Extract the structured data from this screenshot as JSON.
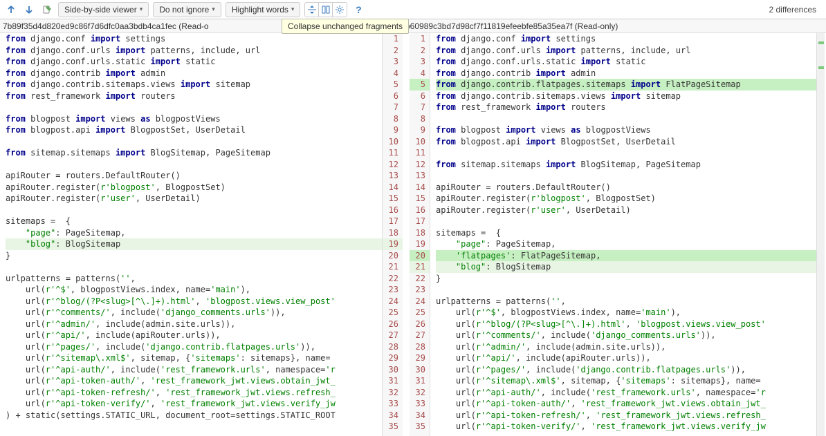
{
  "toolbar": {
    "viewer_mode": "Side-by-side viewer",
    "ignore_mode": "Do not ignore",
    "highlight_mode": "Highlight words",
    "diff_count": "2 differences"
  },
  "tooltip": "Collapse unchanged fragments",
  "headers": {
    "left": "7b89f35d4d820ed9c86f7d6dfc0aa3bdb4ca1fec (Read-o",
    "right": "b60989c3bd7d98cf7f11819efeebfe85a35ea7f (Read-only)"
  },
  "left": {
    "start": 1,
    "lines": [
      {
        "t": [
          [
            "kw",
            "from"
          ],
          [
            "",
            " django.conf "
          ],
          [
            "kw",
            "import"
          ],
          [
            "",
            " settings"
          ]
        ]
      },
      {
        "t": [
          [
            "kw",
            "from"
          ],
          [
            "",
            " django.conf.urls "
          ],
          [
            "kw",
            "import"
          ],
          [
            "",
            " patterns, include, url"
          ]
        ]
      },
      {
        "t": [
          [
            "kw",
            "from"
          ],
          [
            "",
            " django.conf.urls.static "
          ],
          [
            "kw",
            "import"
          ],
          [
            "",
            " static"
          ]
        ]
      },
      {
        "t": [
          [
            "kw",
            "from"
          ],
          [
            "",
            " django.contrib "
          ],
          [
            "kw",
            "import"
          ],
          [
            "",
            " admin"
          ]
        ]
      },
      {
        "t": [
          [
            "kw",
            "from"
          ],
          [
            "",
            " django.contrib.sitemaps.views "
          ],
          [
            "kw",
            "import"
          ],
          [
            "",
            " sitemap"
          ]
        ]
      },
      {
        "t": [
          [
            "kw",
            "from"
          ],
          [
            "",
            " rest_framework "
          ],
          [
            "kw",
            "import"
          ],
          [
            "",
            " routers"
          ]
        ]
      },
      {
        "t": []
      },
      {
        "t": [
          [
            "kw",
            "from"
          ],
          [
            "",
            " blogpost "
          ],
          [
            "kw",
            "import"
          ],
          [
            "",
            " views "
          ],
          [
            "kw",
            "as"
          ],
          [
            "",
            " blogpostViews"
          ]
        ]
      },
      {
        "t": [
          [
            "kw",
            "from"
          ],
          [
            "",
            " blogpost.api "
          ],
          [
            "kw",
            "import"
          ],
          [
            "",
            " BlogpostSet, UserDetail"
          ]
        ]
      },
      {
        "t": []
      },
      {
        "t": [
          [
            "kw",
            "from"
          ],
          [
            "",
            " sitemap.sitemaps "
          ],
          [
            "kw",
            "import"
          ],
          [
            "",
            " BlogSitemap, PageSitemap"
          ]
        ]
      },
      {
        "t": []
      },
      {
        "t": [
          [
            "",
            "apiRouter = routers.DefaultRouter()"
          ]
        ]
      },
      {
        "t": [
          [
            "",
            "apiRouter.register("
          ],
          [
            "str",
            "r'blogpost'"
          ],
          [
            "",
            ", BlogpostSet)"
          ]
        ]
      },
      {
        "t": [
          [
            "",
            "apiRouter.register("
          ],
          [
            "str",
            "r'user'"
          ],
          [
            "",
            ", UserDetail)"
          ]
        ]
      },
      {
        "t": []
      },
      {
        "t": [
          [
            "",
            "sitemaps =  {"
          ]
        ]
      },
      {
        "t": [
          [
            "",
            "    "
          ],
          [
            "str",
            "\"page\""
          ],
          [
            "",
            ": PageSitemap,"
          ]
        ]
      },
      {
        "cls": "mod",
        "t": [
          [
            "",
            "    "
          ],
          [
            "str",
            "\"blog\""
          ],
          [
            "",
            ": BlogSitemap"
          ]
        ]
      },
      {
        "t": [
          [
            "",
            "}"
          ]
        ]
      },
      {
        "t": []
      },
      {
        "t": [
          [
            "",
            "urlpatterns = patterns("
          ],
          [
            "str",
            "''"
          ],
          [
            "",
            ","
          ]
        ]
      },
      {
        "t": [
          [
            "",
            "    url("
          ],
          [
            "str",
            "r'^$'"
          ],
          [
            "",
            ", blogpostViews.index, name="
          ],
          [
            "str",
            "'main'"
          ],
          [
            "",
            "),"
          ]
        ]
      },
      {
        "t": [
          [
            "",
            "    url("
          ],
          [
            "str",
            "r'^blog/(?P<slug>[^\\.]+).html'"
          ],
          [
            "",
            ", "
          ],
          [
            "str",
            "'blogpost.views.view_post'"
          ]
        ]
      },
      {
        "t": [
          [
            "",
            "    url("
          ],
          [
            "str",
            "r'^comments/'"
          ],
          [
            "",
            ", include("
          ],
          [
            "str",
            "'django_comments.urls'"
          ],
          [
            "",
            ")),"
          ]
        ]
      },
      {
        "t": [
          [
            "",
            "    url("
          ],
          [
            "str",
            "r'^admin/'"
          ],
          [
            "",
            ", include(admin.site.urls)),"
          ]
        ]
      },
      {
        "t": [
          [
            "",
            "    url("
          ],
          [
            "str",
            "r'^api/'"
          ],
          [
            "",
            ", include(apiRouter.urls)),"
          ]
        ]
      },
      {
        "t": [
          [
            "",
            "    url("
          ],
          [
            "str",
            "r'^pages/'"
          ],
          [
            "",
            ", include("
          ],
          [
            "str",
            "'django.contrib.flatpages.urls'"
          ],
          [
            "",
            ")),"
          ]
        ]
      },
      {
        "t": [
          [
            "",
            "    url("
          ],
          [
            "str",
            "r'^sitemap\\.xml$'"
          ],
          [
            "",
            ", sitemap, {"
          ],
          [
            "str",
            "'sitemaps'"
          ],
          [
            "",
            ": sitemaps}, name="
          ]
        ]
      },
      {
        "t": [
          [
            "",
            "    url("
          ],
          [
            "str",
            "r'^api-auth/'"
          ],
          [
            "",
            ", include("
          ],
          [
            "str",
            "'rest_framework.urls'"
          ],
          [
            "",
            ", namespace="
          ],
          [
            "str",
            "'r"
          ]
        ]
      },
      {
        "t": [
          [
            "",
            "    url("
          ],
          [
            "str",
            "r'^api-token-auth/'"
          ],
          [
            "",
            ", "
          ],
          [
            "str",
            "'rest_framework_jwt.views.obtain_jwt_"
          ]
        ]
      },
      {
        "t": [
          [
            "",
            "    url("
          ],
          [
            "str",
            "r'^api-token-refresh/'"
          ],
          [
            "",
            ", "
          ],
          [
            "str",
            "'rest_framework_jwt.views.refresh_"
          ]
        ]
      },
      {
        "t": [
          [
            "",
            "    url("
          ],
          [
            "str",
            "r'^api-token-verify/'"
          ],
          [
            "",
            ", "
          ],
          [
            "str",
            "'rest_framework_jwt.views.verify_jw"
          ]
        ]
      },
      {
        "t": [
          [
            "",
            ") + static(settings.STATIC_URL, document_root=settings.STATIC_ROOT"
          ]
        ]
      },
      {
        "t": []
      }
    ]
  },
  "right": {
    "start": 1,
    "lines": [
      {
        "t": [
          [
            "kw",
            "from"
          ],
          [
            "",
            " django.conf "
          ],
          [
            "kw",
            "import"
          ],
          [
            "",
            " settings"
          ]
        ]
      },
      {
        "t": [
          [
            "kw",
            "from"
          ],
          [
            "",
            " django.conf.urls "
          ],
          [
            "kw",
            "import"
          ],
          [
            "",
            " patterns, include, url"
          ]
        ]
      },
      {
        "t": [
          [
            "kw",
            "from"
          ],
          [
            "",
            " django.conf.urls.static "
          ],
          [
            "kw",
            "import"
          ],
          [
            "",
            " static"
          ]
        ]
      },
      {
        "t": [
          [
            "kw",
            "from"
          ],
          [
            "",
            " django.contrib "
          ],
          [
            "kw",
            "import"
          ],
          [
            "",
            " admin"
          ]
        ]
      },
      {
        "cls": "ins",
        "t": [
          [
            "kw",
            "from"
          ],
          [
            "",
            " django.contrib.flatpages.sitemaps "
          ],
          [
            "kw",
            "import"
          ],
          [
            "",
            " FlatPageSitemap"
          ]
        ]
      },
      {
        "t": [
          [
            "kw",
            "from"
          ],
          [
            "",
            " django.contrib.sitemaps.views "
          ],
          [
            "kw",
            "import"
          ],
          [
            "",
            " sitemap"
          ]
        ]
      },
      {
        "t": [
          [
            "kw",
            "from"
          ],
          [
            "",
            " rest_framework "
          ],
          [
            "kw",
            "import"
          ],
          [
            "",
            " routers"
          ]
        ]
      },
      {
        "t": []
      },
      {
        "t": [
          [
            "kw",
            "from"
          ],
          [
            "",
            " blogpost "
          ],
          [
            "kw",
            "import"
          ],
          [
            "",
            " views "
          ],
          [
            "kw",
            "as"
          ],
          [
            "",
            " blogpostViews"
          ]
        ]
      },
      {
        "t": [
          [
            "kw",
            "from"
          ],
          [
            "",
            " blogpost.api "
          ],
          [
            "kw",
            "import"
          ],
          [
            "",
            " BlogpostSet, UserDetail"
          ]
        ]
      },
      {
        "t": []
      },
      {
        "t": [
          [
            "kw",
            "from"
          ],
          [
            "",
            " sitemap.sitemaps "
          ],
          [
            "kw",
            "import"
          ],
          [
            "",
            " BlogSitemap, PageSitemap"
          ]
        ]
      },
      {
        "t": []
      },
      {
        "t": [
          [
            "",
            "apiRouter = routers.DefaultRouter()"
          ]
        ]
      },
      {
        "t": [
          [
            "",
            "apiRouter.register("
          ],
          [
            "str",
            "r'blogpost'"
          ],
          [
            "",
            ", BlogpostSet)"
          ]
        ]
      },
      {
        "t": [
          [
            "",
            "apiRouter.register("
          ],
          [
            "str",
            "r'user'"
          ],
          [
            "",
            ", UserDetail)"
          ]
        ]
      },
      {
        "t": []
      },
      {
        "t": [
          [
            "",
            "sitemaps =  {"
          ]
        ]
      },
      {
        "t": [
          [
            "",
            "    "
          ],
          [
            "str",
            "\"page\""
          ],
          [
            "",
            ": PageSitemap,"
          ]
        ]
      },
      {
        "cls": "ins",
        "t": [
          [
            "",
            "    "
          ],
          [
            "str",
            "'flatpages'"
          ],
          [
            "",
            ": FlatPageSitemap,"
          ]
        ]
      },
      {
        "cls": "mod",
        "t": [
          [
            "",
            "    "
          ],
          [
            "str",
            "\"blog\""
          ],
          [
            "",
            ": BlogSitemap"
          ]
        ]
      },
      {
        "t": [
          [
            "",
            "}"
          ]
        ]
      },
      {
        "t": []
      },
      {
        "t": [
          [
            "",
            "urlpatterns = patterns("
          ],
          [
            "str",
            "''"
          ],
          [
            "",
            ","
          ]
        ]
      },
      {
        "t": [
          [
            "",
            "    url("
          ],
          [
            "str",
            "r'^$'"
          ],
          [
            "",
            ", blogpostViews.index, name="
          ],
          [
            "str",
            "'main'"
          ],
          [
            "",
            "),"
          ]
        ]
      },
      {
        "t": [
          [
            "",
            "    url("
          ],
          [
            "str",
            "r'^blog/(?P<slug>[^\\.]+).html'"
          ],
          [
            "",
            ", "
          ],
          [
            "str",
            "'blogpost.views.view_post'"
          ]
        ]
      },
      {
        "t": [
          [
            "",
            "    url("
          ],
          [
            "str",
            "r'^comments/'"
          ],
          [
            "",
            ", include("
          ],
          [
            "str",
            "'django_comments.urls'"
          ],
          [
            "",
            ")),"
          ]
        ]
      },
      {
        "t": [
          [
            "",
            "    url("
          ],
          [
            "str",
            "r'^admin/'"
          ],
          [
            "",
            ", include(admin.site.urls)),"
          ]
        ]
      },
      {
        "t": [
          [
            "",
            "    url("
          ],
          [
            "str",
            "r'^api/'"
          ],
          [
            "",
            ", include(apiRouter.urls)),"
          ]
        ]
      },
      {
        "t": [
          [
            "",
            "    url("
          ],
          [
            "str",
            "r'^pages/'"
          ],
          [
            "",
            ", include("
          ],
          [
            "str",
            "'django.contrib.flatpages.urls'"
          ],
          [
            "",
            ")),"
          ]
        ]
      },
      {
        "t": [
          [
            "",
            "    url("
          ],
          [
            "str",
            "r'^sitemap\\.xml$'"
          ],
          [
            "",
            ", sitemap, {"
          ],
          [
            "str",
            "'sitemaps'"
          ],
          [
            "",
            ": sitemaps}, name="
          ]
        ]
      },
      {
        "t": [
          [
            "",
            "    url("
          ],
          [
            "str",
            "r'^api-auth/'"
          ],
          [
            "",
            ", include("
          ],
          [
            "str",
            "'rest_framework.urls'"
          ],
          [
            "",
            ", namespace="
          ],
          [
            "str",
            "'r"
          ]
        ]
      },
      {
        "t": [
          [
            "",
            "    url("
          ],
          [
            "str",
            "r'^api-token-auth/'"
          ],
          [
            "",
            ", "
          ],
          [
            "str",
            "'rest_framework_jwt.views.obtain_jwt_"
          ]
        ]
      },
      {
        "t": [
          [
            "",
            "    url("
          ],
          [
            "str",
            "r'^api-token-refresh/'"
          ],
          [
            "",
            ", "
          ],
          [
            "str",
            "'rest_framework_jwt.views.refresh_"
          ]
        ]
      },
      {
        "t": [
          [
            "",
            "    url("
          ],
          [
            "str",
            "r'^api-token-verify/'"
          ],
          [
            "",
            ", "
          ],
          [
            "str",
            "'rest_framework_jwt.views.verify_jw"
          ]
        ]
      }
    ]
  }
}
